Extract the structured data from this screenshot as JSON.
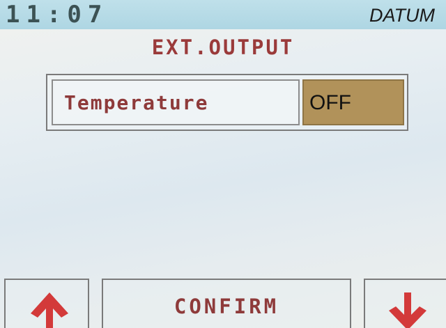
{
  "status_bar": {
    "clock": "11:07",
    "brand": "DATUM"
  },
  "screen": {
    "title": "EXT.OUTPUT"
  },
  "setting": {
    "label": "Temperature",
    "value": "OFF"
  },
  "softkeys": {
    "up_icon": "arrow-up-icon",
    "confirm_label": "CONFIRM",
    "down_icon": "arrow-down-icon"
  },
  "colors": {
    "status_bar": "#aed6e3",
    "label_text": "#8e3a3a",
    "value_cell": "#b1925a",
    "arrow": "#d33a3a"
  }
}
